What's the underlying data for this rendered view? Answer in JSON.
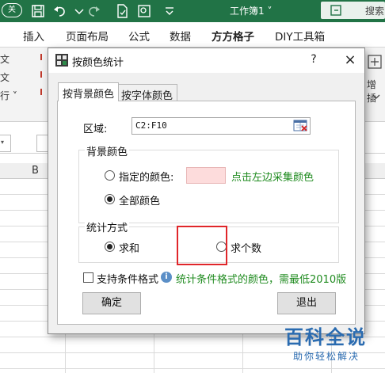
{
  "excel": {
    "toggle_label": "关",
    "workbook_title": "工作簿1 ˅",
    "search_label": "搜索",
    "tabs": [
      "插入",
      "页面布局",
      "公式",
      "数据",
      "方方格子",
      "DIY工具箱"
    ],
    "active_tab": "方方格子",
    "ribbon_left": [
      "文",
      "文",
      "行 ˅"
    ],
    "ribbon_right": "增插",
    "column_header": "B",
    "accent_color": "#217346"
  },
  "dialog": {
    "title": "按颜色统计",
    "help": "?",
    "close": "×",
    "tabs": [
      "按背景颜色",
      "按字体颜色"
    ],
    "active_tab": "按背景颜色",
    "range_label": "区域:",
    "range_value": "C2:F10",
    "bg_group_title": "背景颜色",
    "option_specified": "指定的颜色:",
    "pick_hint": "点击左边采集颜色",
    "option_all": "全部颜色",
    "bg_selected": "全部颜色",
    "swatch_color": "#fddcdc",
    "stat_group_title": "统计方式",
    "stat_sum": "求和",
    "stat_count": "求个数",
    "stat_selected": "求和",
    "conditional_label": "支持条件格式",
    "conditional_checked": false,
    "info_icon": "i",
    "conditional_hint": "统计条件格式的颜色，需最低2010版",
    "ok_label": "确定",
    "exit_label": "退出"
  },
  "watermark": {
    "main": "百科全说",
    "sub": "助你轻松解决"
  }
}
